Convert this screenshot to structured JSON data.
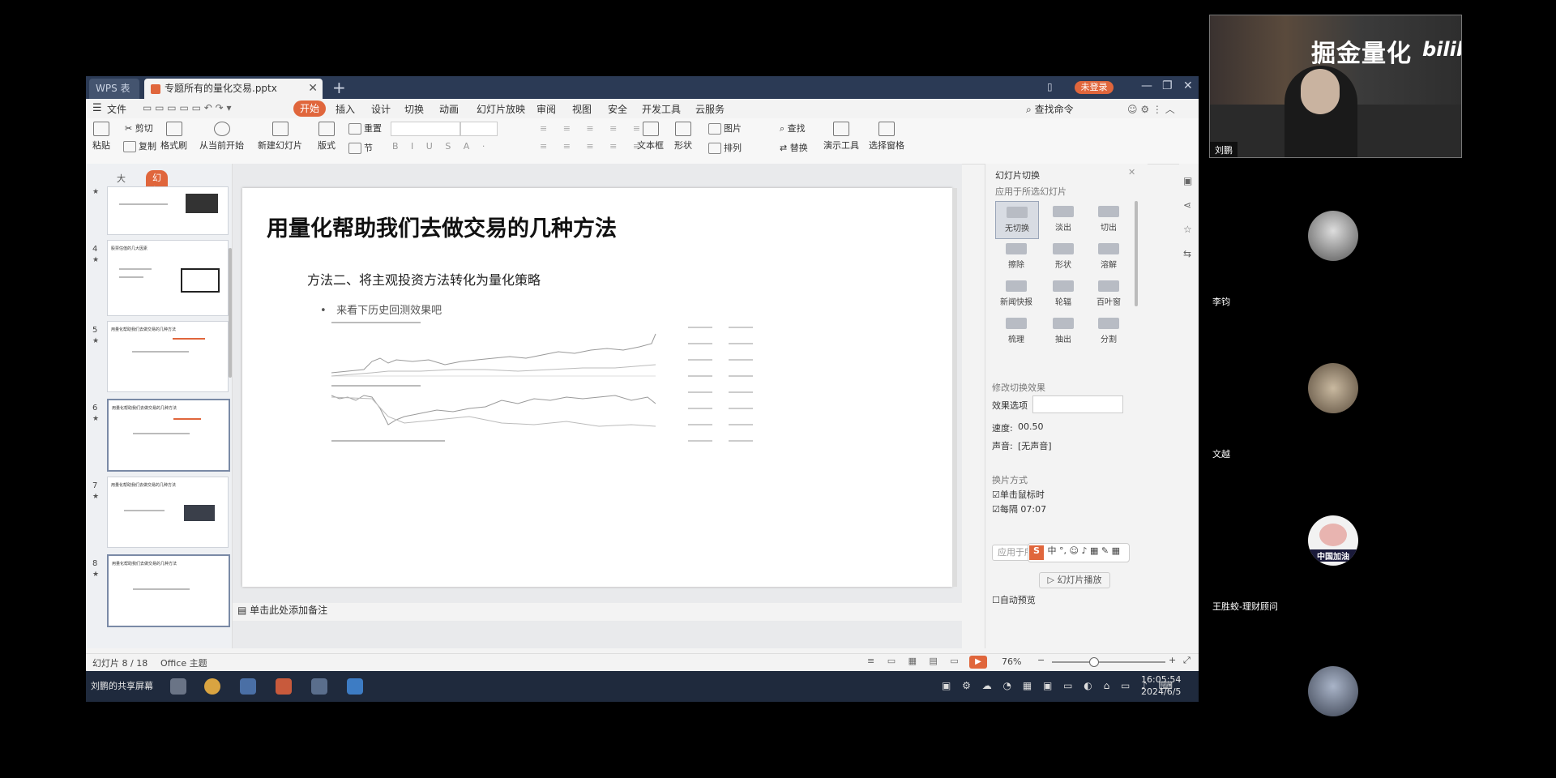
{
  "screen": {
    "tabs": [
      {
        "label": "WPS 表格"
      },
      {
        "label": "专题所有的量化交易.pptx"
      }
    ],
    "login_label": "未登录",
    "window_controls": [
      "—",
      "❐",
      "✕"
    ],
    "menu": [
      "文件",
      "开始",
      "插入",
      "设计",
      "切换",
      "动画",
      "幻灯片放映",
      "审阅",
      "视图",
      "安全",
      "开发工具",
      "云服务"
    ],
    "search_command": "查找命令",
    "ribbon": {
      "cut": "剪切",
      "copy": "复制",
      "paste": "粘贴",
      "format_painter": "格式刷",
      "from_current": "从当前开始",
      "new_slide": "新建幻灯片",
      "layout": "版式",
      "reset": "重置",
      "section": "节",
      "textbox": "文本框",
      "shape": "形状",
      "arrange": "排列",
      "picture": "图片",
      "find": "查找",
      "replace": "替换",
      "presenter_tools": "演示工具",
      "select_pane": "选择窗格"
    },
    "left_panel": {
      "tab_outline": "大纲",
      "tab_slides": "幻灯片",
      "thumbs": [
        {
          "num": "",
          "title": ""
        },
        {
          "num": "4",
          "title": "股票估值的几大因素"
        },
        {
          "num": "5",
          "title": "用量化帮助我们去做交易的几种方法"
        },
        {
          "num": "6",
          "title": "用量化帮助我们去做交易的几种方法"
        },
        {
          "num": "7",
          "title": "用量化帮助我们去做交易的几种方法"
        },
        {
          "num": "8",
          "title": "用量化帮助我们去做交易的几种方法"
        }
      ]
    },
    "slide": {
      "title": "用量化帮助我们去做交易的几种方法",
      "subtitle": "方法二、将主观投资方法转化为量化策略",
      "bullet": "来看下历史回测效果吧"
    },
    "notes_placeholder": "单击此处添加备注",
    "right_panel": {
      "header": "幻灯片切换",
      "apply_label": "应用于所选幻灯片",
      "effects": [
        "无切换",
        "淡出",
        "切出",
        "擦除",
        "形状",
        "溶解",
        "新闻快报",
        "轮辐",
        "百叶窗",
        "梳理",
        "抽出",
        "分割"
      ],
      "modify_header": "修改切换效果",
      "effect_option": "效果选项",
      "speed_label": "速度:",
      "speed_value": "00.50",
      "sound_label": "声音:",
      "sound_value": "[无声音]",
      "advance_header": "换片方式",
      "on_click": "单击鼠标时",
      "every": "每隔",
      "every_value": "07:07",
      "apply_all": "应用于所有",
      "auto_preview": "自动预览",
      "play": "幻灯片播放"
    },
    "status": {
      "slide_pos": "幻灯片 8 / 18",
      "theme": "Office 主题",
      "zoom": "76%"
    },
    "taskbar": {
      "sharing": "刘鹏的共享屏幕",
      "time": "16:05:54",
      "date": "2024/6/5"
    }
  },
  "video": {
    "host_caption": "刘鹏",
    "overlay_title": "掘金量化",
    "overlay_logo": "bilibili",
    "participants": [
      {
        "name": "李钧"
      },
      {
        "name": "文越"
      },
      {
        "name": "王胜蛟-理财顾问",
        "badge": "中国加油"
      },
      {
        "name": ""
      }
    ]
  },
  "colors": {
    "accent": "#e0663c",
    "titlebar": "#2b3a55",
    "taskbar": "#1f2a3d"
  }
}
